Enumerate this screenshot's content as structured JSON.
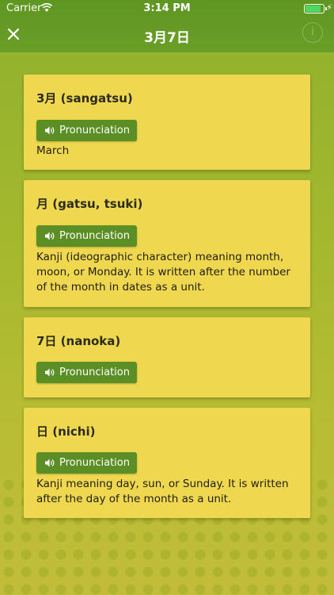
{
  "status": {
    "carrier": "Carrier",
    "time": "3:14 PM"
  },
  "header": {
    "title": "3月7日"
  },
  "cards": [
    {
      "title": "3月 (sangatsu)",
      "button": "Pronunciation",
      "description": "March"
    },
    {
      "title": "月 (gatsu, tsuki)",
      "button": "Pronunciation",
      "description": "Kanji (ideographic character) meaning month, moon, or Monday. It is written after the number of the month in dates as a unit."
    },
    {
      "title": "7日 (nanoka)",
      "button": "Pronunciation",
      "description": ""
    },
    {
      "title": "日 (nichi)",
      "button": "Pronunciation",
      "description": "Kanji meaning day, sun, or Sunday. It is written after the day of the month as a unit."
    }
  ],
  "icons": {
    "close": "close-icon",
    "info": "info-icon",
    "speaker": "speaker-icon",
    "wifi": "wifi-icon",
    "battery": "battery-icon"
  },
  "colors": {
    "header": "#6a9f27",
    "card": "#efd850",
    "button": "#5b8f26"
  }
}
